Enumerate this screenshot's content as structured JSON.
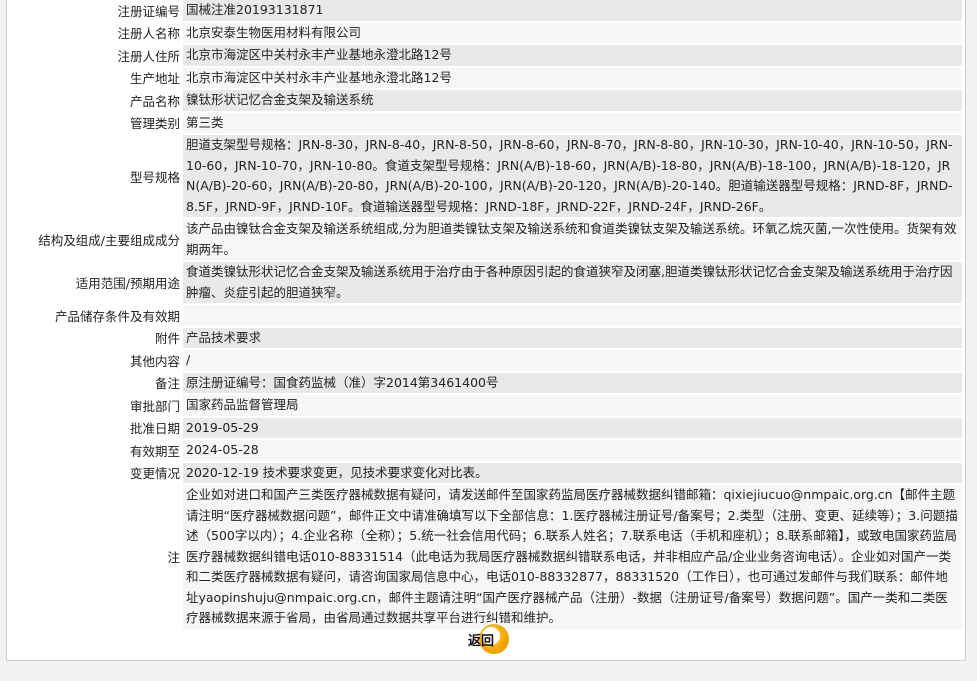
{
  "rows": [
    {
      "label": "注册证编号",
      "value": "国械注准20193131871"
    },
    {
      "label": "注册人名称",
      "value": "北京安泰生物医用材料有限公司"
    },
    {
      "label": "注册人住所",
      "value": "北京市海淀区中关村永丰产业基地永澄北路12号"
    },
    {
      "label": "生产地址",
      "value": "北京市海淀区中关村永丰产业基地永澄北路12号"
    },
    {
      "label": "产品名称",
      "value": "镍钛形状记忆合金支架及输送系统"
    },
    {
      "label": "管理类别",
      "value": "第三类"
    },
    {
      "label": "型号规格",
      "value": "胆道支架型号规格：JRN-8-30，JRN-8-40，JRN-8-50，JRN-8-60，JRN-8-70，JRN-8-80，JRN-10-30，JRN-10-40，JRN-10-50，JRN-10-60，JRN-10-70，JRN-10-80。食道支架型号规格：JRN(A/B)-18-60，JRN(A/B)-18-80，JRN(A/B)-18-100，JRN(A/B)-18-120，JRN(A/B)-20-60，JRN(A/B)-20-80，JRN(A/B)-20-100，JRN(A/B)-20-120，JRN(A/B)-20-140。胆道输送器型号规格：JRND-8F，JRND-8.5F，JRND-9F，JRND-10F。食道输送器型号规格：JRND-18F，JRND-22F，JRND-24F，JRND-26F。"
    },
    {
      "label": "结构及组成/主要组成成分",
      "value": "该产品由镍钛合金支架及输送系统组成,分为胆道类镍钛支架及输送系统和食道类镍钛支架及输送系统。环氧乙烷灭菌,一次性使用。货架有效期两年。"
    },
    {
      "label": "适用范围/预期用途",
      "value": "食道类镍钛形状记忆合金支架及输送系统用于治疗由于各种原因引起的食道狭窄及闭塞,胆道类镍钛形状记忆合金支架及输送系统用于治疗因肿瘤、炎症引起的胆道狭窄。"
    },
    {
      "label": "产品储存条件及有效期",
      "value": ""
    },
    {
      "label": "附件",
      "value": "产品技术要求"
    },
    {
      "label": "其他内容",
      "value": "/"
    },
    {
      "label": "备注",
      "value": "原注册证编号：国食药监械（准）字2014第3461400号"
    },
    {
      "label": "审批部门",
      "value": "国家药品监督管理局"
    },
    {
      "label": "批准日期",
      "value": "2019-05-29"
    },
    {
      "label": "有效期至",
      "value": "2024-05-28"
    },
    {
      "label": "变更情况",
      "value": "2020-12-19 技术要求变更，见技术要求变化对比表。"
    },
    {
      "label": "注",
      "value": "企业如对进口和国产三类医疗器械数据有疑问，请发送邮件至国家药监局医疗器械数据纠错邮箱：qixiejiucuo@nmpaic.org.cn【邮件主题请注明“医疗器械数据问题”，邮件正文中请准确填写以下全部信息：1.医疗器械注册证号/备案号；2.类型（注册、变更、延续等）；3.问题描述（500字以内）；4.企业名称（全称）；5.统一社会信用代码；6.联系人姓名；7.联系电话（手机和座机）；8.联系邮箱】，或致电国家药监局医疗器械数据纠错电话010-88331514（此电话为我局医疗器械数据纠错联系电话，并非相应产品/企业业务咨询电话）。企业如对国产一类和二类医疗器械数据有疑问，请咨询国家局信息中心，电话010-88332877，88331520（工作日），也可通过发邮件与我们联系：邮件地址yaopinshuju@nmpaic.org.cn，邮件主题请注明“国产医疗器械产品（注册）-数据（注册证号/备案号）数据问题”。国产一类和二类医疗器械数据来源于省局，由省局通过数据共享平台进行纠错和维护。"
    }
  ],
  "back_button": {
    "label": "返回"
  }
}
